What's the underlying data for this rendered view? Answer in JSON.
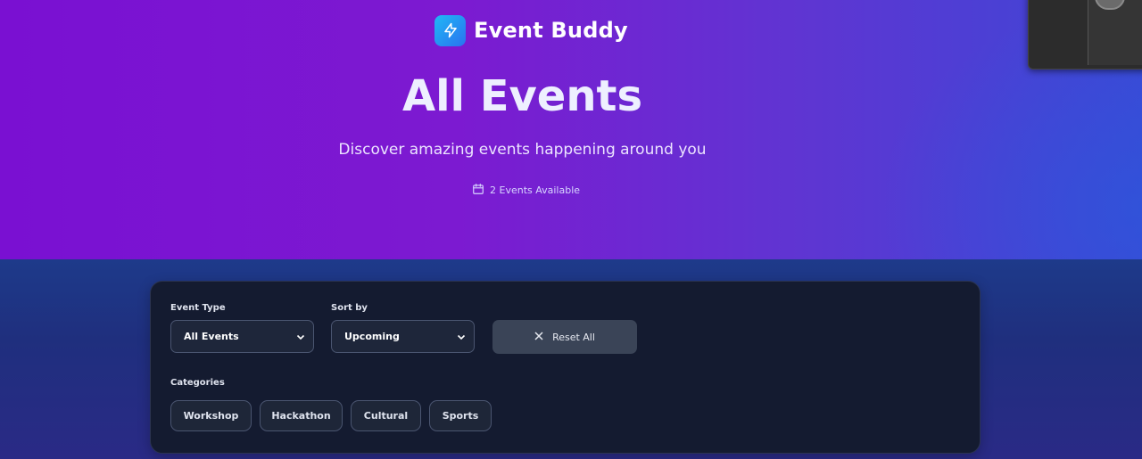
{
  "brand": {
    "name": "Event Buddy",
    "logo_icon": "lightning-icon"
  },
  "hero": {
    "title": "All Events",
    "subtitle": "Discover amazing events happening around you",
    "count_text": "2 Events Available",
    "count_icon": "calendar-icon"
  },
  "filters": {
    "event_type": {
      "label": "Event Type",
      "value": "All Events"
    },
    "sort_by": {
      "label": "Sort by",
      "value": "Upcoming"
    },
    "reset_label": "Reset All",
    "categories_label": "Categories",
    "categories": [
      "Workshop",
      "Hackathon",
      "Cultural",
      "Sports"
    ]
  },
  "colors": {
    "hero_start": "#7a10d2",
    "hero_end": "#3c48d6",
    "panel_bg": "#141b30",
    "logo": "#20b8f5"
  }
}
